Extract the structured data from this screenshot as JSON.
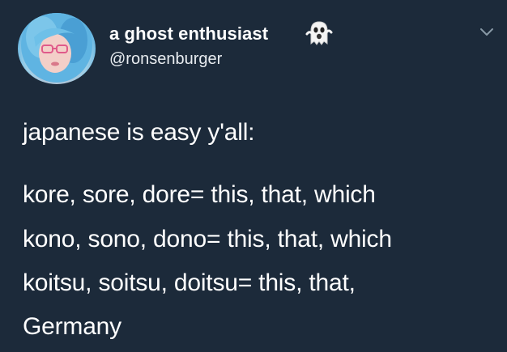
{
  "tweet": {
    "author": {
      "display_name": "a ghost enthusiast",
      "name_emoji": "ghost-icon",
      "handle": "@ronsenburger",
      "avatar": "avatar"
    },
    "menu_icon": "chevron-down-icon",
    "body_lines": [
      "japanese is easy y'all:",
      "kore, sore, dore= this, that, which",
      "kono, sono, dono= this, that, which",
      "koitsu, soitsu, doitsu= this, that,",
      "Germany"
    ]
  },
  "colors": {
    "background": "#1c2a3a",
    "text": "#ffffff",
    "chevron": "#8899a6"
  }
}
